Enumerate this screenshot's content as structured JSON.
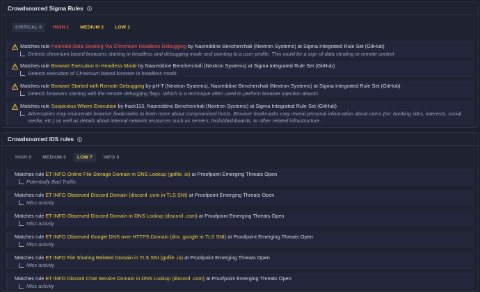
{
  "sigma": {
    "title": "Crowdsourced Sigma Rules",
    "tabs": [
      {
        "label": "CRITICAL 0",
        "color": "#8a8f9f"
      },
      {
        "label": "HIGH 1",
        "color": "#f0564e"
      },
      {
        "label": "MEDIUM 2",
        "color": "#f2d13a"
      },
      {
        "label": "LOW 1",
        "color": "#f2d13a"
      }
    ],
    "rules": [
      {
        "prefix": "Matches rule ",
        "name": "Potential Data Stealing Via Chromium Headless Debugging",
        "severity": "high",
        "suffix": " by Nasreddine Bencherchali (Nextron Systems) at Sigma Integrated Rule Set (GitHub)",
        "description": "Detects chromium based browsers starting in headless and debugging mode and pointing to a user profile. This could be a sign of data stealing or remote control"
      },
      {
        "prefix": "Matches rule ",
        "name": "Browser Execution In Headless Mode",
        "severity": "medium",
        "suffix": " by Nasreddine Bencherchali (Nextron Systems) at Sigma Integrated Rule Set (GitHub)",
        "description": "Detects execution of Chromium based browser in headless mode"
      },
      {
        "prefix": "Matches rule ",
        "name": "Browser Started with Remote Debugging",
        "severity": "medium",
        "suffix": " by pH-T (Nextron Systems), Nasreddine Bencherchali (Nextron Systems) at Sigma Integrated Rule Set (GitHub)",
        "description": "Detects browsers starting with the remote debugging flags. Which is a technique often used to perform browser injection attacks"
      },
      {
        "prefix": "Matches rule ",
        "name": "Suspicious Where Execution",
        "severity": "low",
        "suffix": " by frack113, Nasreddine Bencherchali (Nextron Systems) at Sigma Integrated Rule Set (GitHub)",
        "description": "Adversaries may enumerate browser bookmarks to learn more about compromised hosts. Browser bookmarks may reveal personal information about users (ex: banking sites, interests, social media, etc.) as well as details about internal network resources such as servers, tools/dashboards, or other related infrastructure."
      }
    ]
  },
  "ids": {
    "title": "Crowdsourced IDS rules",
    "tabs": [
      {
        "label": "HIGH 0",
        "color": "#8a8f9f"
      },
      {
        "label": "MEDIUM 0",
        "color": "#8a8f9f"
      },
      {
        "label": "LOW 7",
        "color": "#f2d13a"
      },
      {
        "label": "INFO 0",
        "color": "#8a8f9f"
      }
    ],
    "rules": [
      {
        "prefix": "Matches rule ",
        "name": "ET INFO Online File Storage Domain in DNS Lookup (gofile .io)",
        "suffix": " at Proofpoint Emerging Threats Open",
        "description": "Potentially Bad Traffic"
      },
      {
        "prefix": "Matches rule ",
        "name": "ET INFO Observed Discord Domain (discord .com in TLS SNI)",
        "suffix": " at Proofpoint Emerging Threats Open",
        "description": "Misc activity"
      },
      {
        "prefix": "Matches rule ",
        "name": "ET INFO Observed Discord Domain in DNS Lookup (discord .com)",
        "suffix": " at Proofpoint Emerging Threats Open",
        "description": "Misc activity"
      },
      {
        "prefix": "Matches rule ",
        "name": "ET INFO Observed Google DNS over HTTPS Domain (dns .google in TLS SNI)",
        "suffix": " at Proofpoint Emerging Threats Open",
        "description": "Misc activity"
      },
      {
        "prefix": "Matches rule ",
        "name": "ET INFO File Sharing Related Domain in TLS SNI (gofile .io)",
        "suffix": " at Proofpoint Emerging Threats Open",
        "description": "Misc activity"
      },
      {
        "prefix": "Matches rule ",
        "name": "ET INFO Discord Chat Service Domain in DNS Lookup (discord .com)",
        "suffix": " at Proofpoint Emerging Threats Open",
        "description": "Misc activity"
      }
    ]
  },
  "colors": {
    "high": "#f0564e",
    "medium": "#f2d13a",
    "low": "#f2d13a",
    "muted": "#8a8f9f"
  },
  "icons": {
    "warning": "warning-triangle-icon",
    "info": "info-circle-icon",
    "subitem": "return-arrow-icon"
  }
}
